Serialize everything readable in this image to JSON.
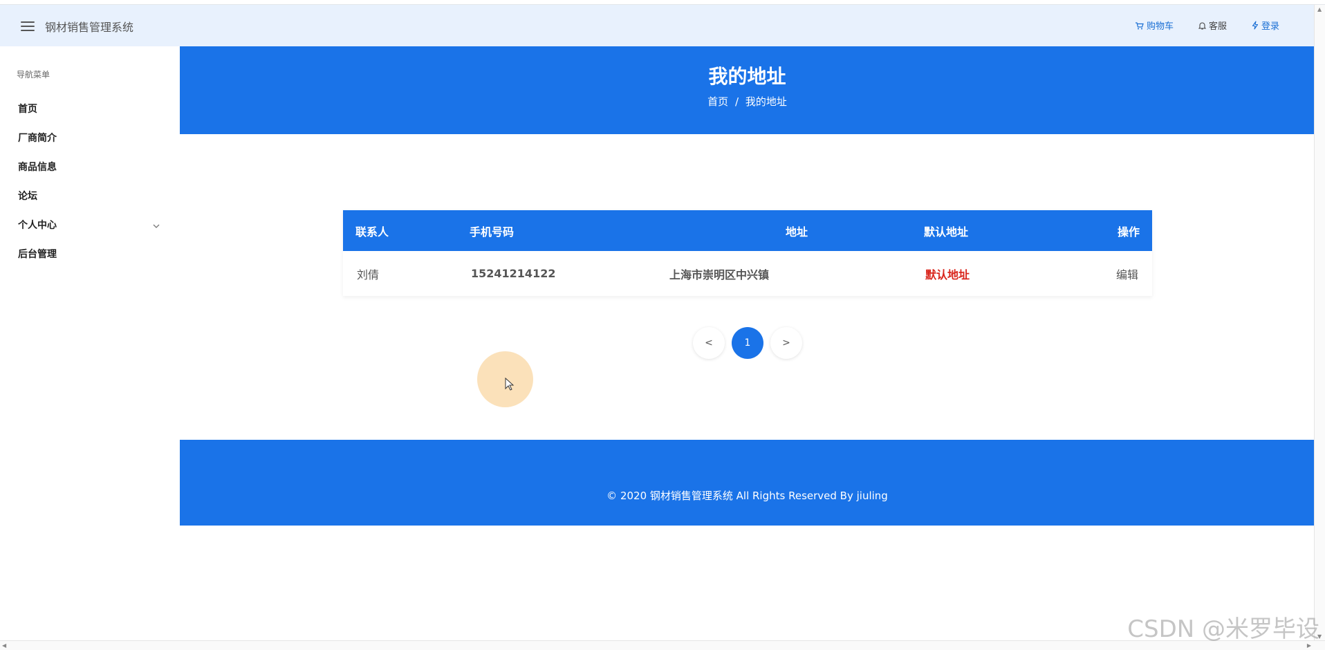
{
  "header": {
    "app_title": "钢材销售管理系统",
    "links": [
      {
        "label": "购物车",
        "icon": "cart-icon"
      },
      {
        "label": "客服",
        "icon": "bell-icon"
      },
      {
        "label": "登录",
        "icon": "lightning-icon"
      }
    ]
  },
  "sidebar": {
    "title": "导航菜单",
    "items": [
      {
        "label": "首页"
      },
      {
        "label": "厂商简介"
      },
      {
        "label": "商品信息"
      },
      {
        "label": "论坛"
      },
      {
        "label": "个人中心",
        "icon": "chevron-down-icon"
      },
      {
        "label": "后台管理"
      }
    ]
  },
  "banner": {
    "title": "我的地址",
    "breadcrumb_home": "首页",
    "breadcrumb_sep": "/",
    "breadcrumb_current": "我的地址"
  },
  "table": {
    "headers": [
      "联系人",
      "手机号码",
      "地址",
      "默认地址",
      "操作"
    ],
    "rows": [
      {
        "contact": "刘倩",
        "phone": "15241214122",
        "address": "上海市崇明区中兴镇",
        "default": "默认地址",
        "action": "编辑"
      }
    ]
  },
  "pagination": {
    "prev": "<",
    "current": "1",
    "next": ">"
  },
  "footer": {
    "text": "© 2020 钢材销售管理系统 All Rights Reserved By jiuling"
  },
  "watermark": "CSDN @米罗毕设",
  "colors": {
    "primary": "#1a73e8",
    "header_bg": "#e8f1fd",
    "default_red": "#d9251c"
  }
}
